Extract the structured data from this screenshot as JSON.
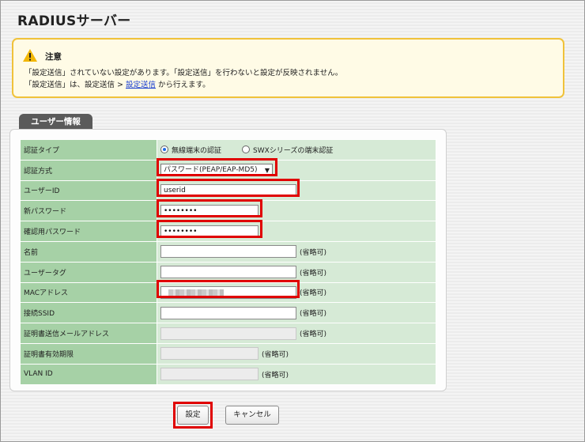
{
  "page": {
    "title": "RADIUSサーバー"
  },
  "notice": {
    "title": "注意",
    "line1": "「設定送信」されていない設定があります。「設定送信」を行わないと設定が反映されません。",
    "line2_before": "「設定送信」は、設定送信 > ",
    "line2_link": "設定送信",
    "line2_after": " から行えます。",
    "icon": "warning-triangle-icon",
    "accent_color": "#f0c23a"
  },
  "section": {
    "tab_label": "ユーザー情報"
  },
  "form": {
    "auth_type": {
      "label": "認証タイプ",
      "options": [
        "無線端末の認証",
        "SWXシリーズの端末認証"
      ],
      "selected": "無線端末の認証"
    },
    "auth_method": {
      "label": "認証方式",
      "value": "パスワード(PEAP/EAP-MD5)"
    },
    "user_id": {
      "label": "ユーザーID",
      "value": "userid"
    },
    "new_password": {
      "label": "新パスワード",
      "value": "••••••••"
    },
    "confirm_password": {
      "label": "確認用パスワード",
      "value": "••••••••"
    },
    "name": {
      "label": "名前",
      "value": "",
      "note": "(省略可)"
    },
    "user_tag": {
      "label": "ユーザータグ",
      "value": "",
      "note": "(省略可)"
    },
    "mac_address": {
      "label": "MACアドレス",
      "value": "",
      "note": "(省略可)"
    },
    "ssid": {
      "label": "接続SSID",
      "value": "",
      "note": "(省略可)"
    },
    "cert_email": {
      "label": "証明書送信メールアドレス",
      "value": "",
      "note": "(省略可)"
    },
    "cert_expiry": {
      "label": "証明書有効期限",
      "value": "",
      "note": "(省略可)"
    },
    "vlan_id": {
      "label": "VLAN ID",
      "value": "",
      "note": "(省略可)"
    }
  },
  "buttons": {
    "submit": "設定",
    "cancel": "キャンセル"
  },
  "colors": {
    "label_bg": "#a6d1a6",
    "value_bg": "#d6ead6",
    "highlight": "#e00000",
    "tab_bg": "#5a5a5a"
  }
}
